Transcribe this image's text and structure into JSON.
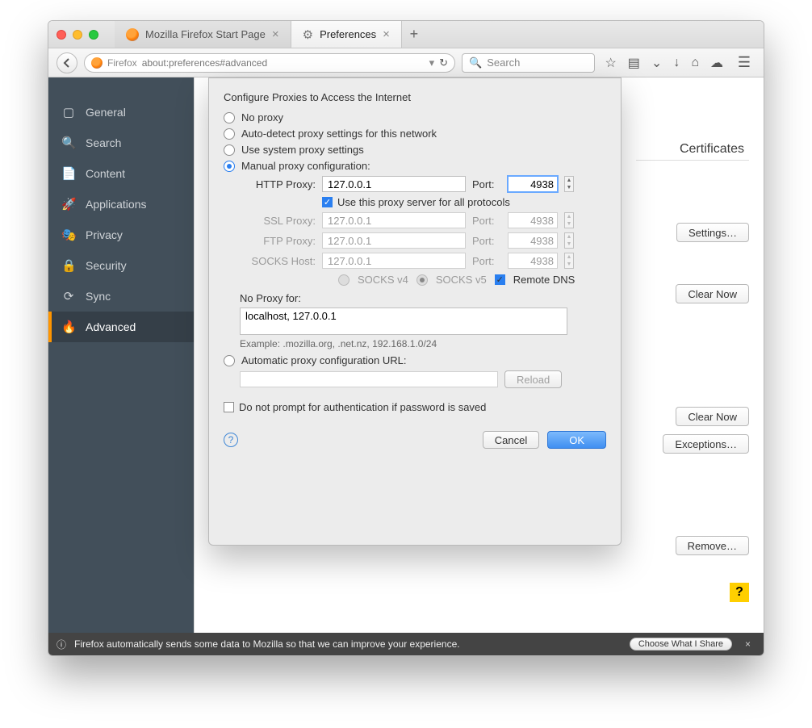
{
  "tabs": {
    "inactive_label": "Mozilla Firefox Start Page",
    "active_label": "Preferences"
  },
  "urlbar": {
    "brand": "Firefox",
    "url": "about:preferences#advanced"
  },
  "search_placeholder": "Search",
  "sidebar": {
    "items": [
      {
        "label": "General"
      },
      {
        "label": "Search"
      },
      {
        "label": "Content"
      },
      {
        "label": "Applications"
      },
      {
        "label": "Privacy"
      },
      {
        "label": "Security"
      },
      {
        "label": "Sync"
      },
      {
        "label": "Advanced"
      }
    ]
  },
  "peek": {
    "certificates": "Certificates",
    "settings": "Settings…",
    "clear_now": "Clear Now",
    "exceptions": "Exceptions…",
    "remove": "Remove…"
  },
  "notice": {
    "text": "Firefox automatically sends some data to Mozilla so that we can improve your experience.",
    "button": "Choose What I Share"
  },
  "dialog": {
    "title": "Configure Proxies to Access the Internet",
    "radios": {
      "no_proxy": "No proxy",
      "auto_detect": "Auto-detect proxy settings for this network",
      "use_system": "Use system proxy settings",
      "manual": "Manual proxy configuration:",
      "auto_url": "Automatic proxy configuration URL:"
    },
    "fields": {
      "http_label": "HTTP Proxy:",
      "ssl_label": "SSL Proxy:",
      "ftp_label": "FTP Proxy:",
      "socks_label": "SOCKS Host:",
      "port_label": "Port:",
      "http_host": "127.0.0.1",
      "http_port": "4938",
      "ssl_host": "127.0.0.1",
      "ssl_port": "4938",
      "ftp_host": "127.0.0.1",
      "ftp_port": "4938",
      "socks_host": "127.0.0.1",
      "socks_port": "4938"
    },
    "use_for_all": "Use this proxy server for all protocols",
    "socks_v4": "SOCKS v4",
    "socks_v5": "SOCKS v5",
    "remote_dns": "Remote DNS",
    "no_proxy_for_label": "No Proxy for:",
    "no_proxy_for_value": "localhost, 127.0.0.1",
    "example": "Example: .mozilla.org, .net.nz, 192.168.1.0/24",
    "reload": "Reload",
    "do_not_prompt": "Do not prompt for authentication if password is saved",
    "cancel": "Cancel",
    "ok": "OK"
  }
}
